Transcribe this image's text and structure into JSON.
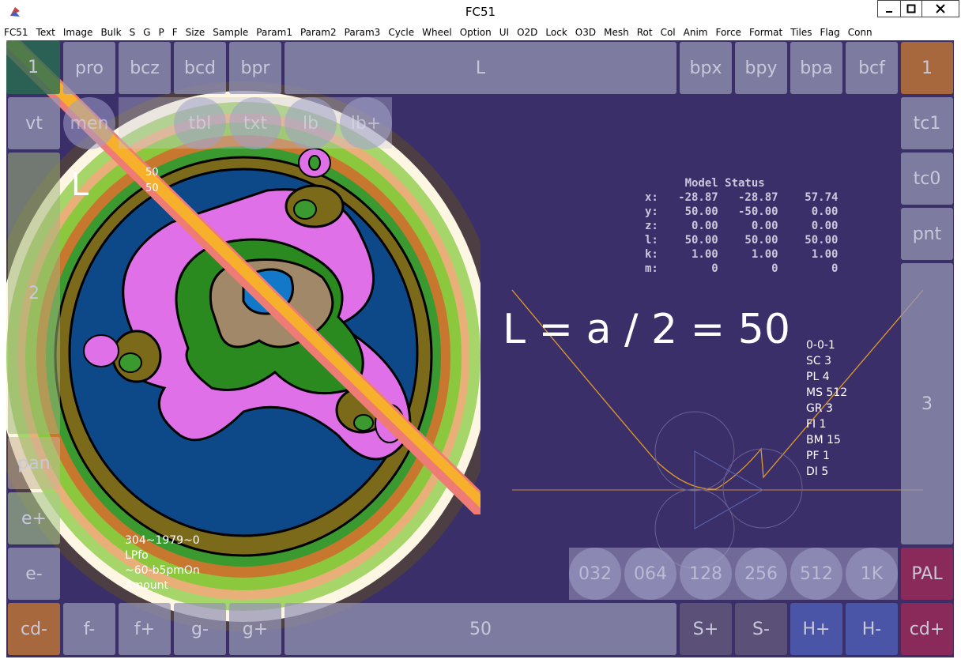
{
  "window": {
    "title": "FC51"
  },
  "menu": [
    "FC51",
    "Text",
    "Image",
    "Bulk",
    "S",
    "G",
    "P",
    "F",
    "Size",
    "Sample",
    "Param1",
    "Param2",
    "Param3",
    "Cycle",
    "Wheel",
    "Option",
    "UI",
    "O2D",
    "Lock",
    "O3D",
    "Mesh",
    "Rot",
    "Col",
    "Anim",
    "Force",
    "Format",
    "Tiles",
    "Flag",
    "Conn"
  ],
  "top_buttons": {
    "b1": "1",
    "pro": "pro",
    "bcz": "bcz",
    "bcd": "bcd",
    "bpr": "bpr",
    "L": "L",
    "bpx": "bpx",
    "bpy": "bpy",
    "bpa": "bpa",
    "bcf": "bcf",
    "b1r": "1"
  },
  "left_buttons": {
    "vt": "vt",
    "b2": "2",
    "pan": "pan",
    "e_plus": "e+",
    "e_minus": "e-"
  },
  "right_buttons": {
    "tc1": "tc1",
    "tc0": "tc0",
    "pnt": "pnt",
    "b3": "3",
    "PAL": "PAL"
  },
  "bottom_buttons": {
    "cd_minus": "cd-",
    "f_minus": "f-",
    "f_plus": "f+",
    "g_minus": "g-",
    "g_plus": "g+",
    "value": "50",
    "S_plus": "S+",
    "S_minus": "S-",
    "H_plus": "H+",
    "H_minus": "H-",
    "cd_plus": "cd+"
  },
  "overlay_circles": [
    "men",
    "tbl",
    "txt",
    "lb",
    "lb+"
  ],
  "resolution_circles": [
    "032",
    "064",
    "128",
    "256",
    "512",
    "1K"
  ],
  "model_status": {
    "title": "Model Status",
    "rows": [
      {
        "label": "x:",
        "v1": "-28.87",
        "v2": "-28.87",
        "v3": "57.74"
      },
      {
        "label": "y:",
        "v1": "50.00",
        "v2": "-50.00",
        "v3": "0.00"
      },
      {
        "label": "z:",
        "v1": "0.00",
        "v2": "0.00",
        "v3": "0.00"
      },
      {
        "label": "l:",
        "v1": "50.00",
        "v2": "50.00",
        "v3": "50.00"
      },
      {
        "label": "k:",
        "v1": "1.00",
        "v2": "1.00",
        "v3": "1.00"
      },
      {
        "label": "m:",
        "v1": "0",
        "v2": "0",
        "v3": "0"
      }
    ]
  },
  "formula": "L = a / 2 = 50",
  "params": [
    "0-0-1",
    "SC 3",
    "PL 4",
    "MS 512",
    "GR 3",
    "FI 1",
    "BM 15",
    "PF 1",
    "DI 5"
  ],
  "l_label": "L",
  "l_values": [
    "50",
    "50"
  ],
  "info_lines": [
    "304~1979~0",
    "LPfo",
    "~60-b5pmOn",
    "Amount"
  ],
  "colors": {
    "background": "#3b2f6a",
    "button": "#9696b4",
    "orange_button": "#b5703f",
    "maroon_button": "#8a2a5a",
    "blue_button": "#4a55a8",
    "dark_button": "#5a5078"
  }
}
